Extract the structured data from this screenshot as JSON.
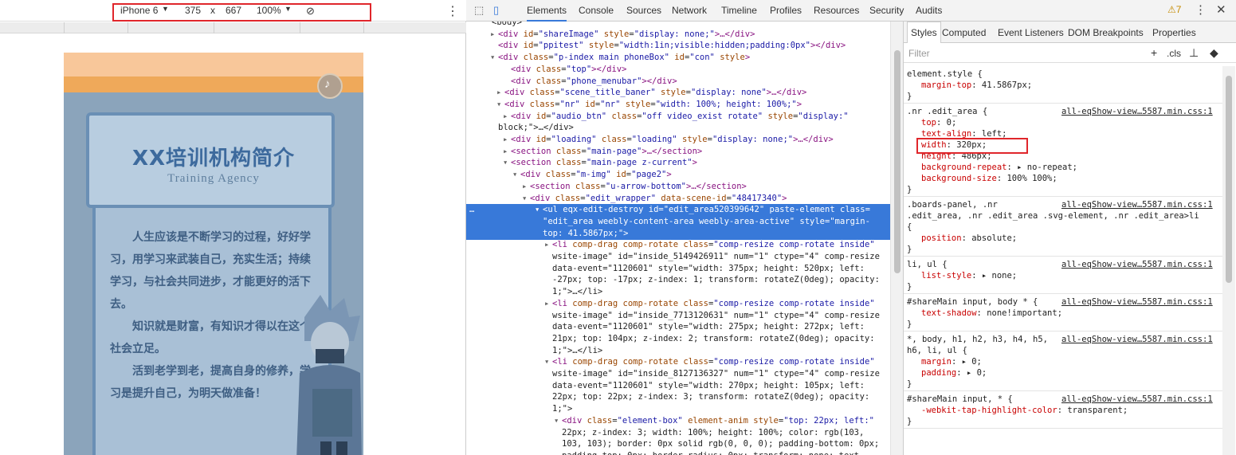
{
  "device_toolbar": {
    "device_name": "iPhone 6",
    "width": "375",
    "times": "x",
    "height": "667",
    "zoom": "100%",
    "rotate_icon": "rotate-icon",
    "more_icon": "kebab-icon"
  },
  "phone": {
    "title": "XX培训机构简介",
    "subtitle": "Training Agency",
    "paragraphs": [
      "人生应该是不断学习的过程，好好学习，用学习来武装自己，充实生活；持续学习，与社会共同进步，才能更好的活下去。",
      "知识就是财富，有知识才得以在这个社会立足。",
      "活到老学到老，提高自身的修养，学习是提升自己，为明天做准备！"
    ],
    "music_icon": "music-note-icon",
    "colors": {
      "top_band": "#f8c79a",
      "orange_band": "#efa95a",
      "background": "#8ba4bb",
      "title": "#3d6a9d"
    }
  },
  "devtools": {
    "tabs": [
      "Elements",
      "Console",
      "Sources",
      "Network",
      "Timeline",
      "Profiles",
      "Resources",
      "Security",
      "Audits"
    ],
    "active_tab": "Elements",
    "warnings": "7",
    "inspect_icon": "inspect-icon",
    "device_icon": "device-mode-icon",
    "close_icon": "close-icon"
  },
  "dom_tree": [
    {
      "t": "",
      "html": "<body>"
    },
    {
      "t": "▸",
      "tag": "div",
      "attrs": [
        [
          "id",
          "shareImage"
        ],
        [
          "style",
          "display: none;"
        ]
      ],
      "tail": ">…</div>"
    },
    {
      "t": "",
      "tag": "div",
      "attrs": [
        [
          "id",
          "ppitest"
        ],
        [
          "style",
          "width:1in;visible:hidden;padding:0px"
        ]
      ],
      "tail": "></div>"
    },
    {
      "t": "▾",
      "tag": "div",
      "attrs": [
        [
          "class",
          "p-index main phoneBox"
        ],
        [
          "id",
          "con"
        ],
        [
          "style",
          ""
        ]
      ],
      "tail": ">"
    },
    {
      "t": "",
      "tag": "div",
      "attrs": [
        [
          "class",
          "top"
        ]
      ],
      "tail": "></div>"
    },
    {
      "t": "",
      "tag": "div",
      "attrs": [
        [
          "class",
          "phone_menubar"
        ]
      ],
      "tail": "></div>"
    },
    {
      "t": "▸",
      "tag": "div",
      "attrs": [
        [
          "class",
          "scene_title_baner"
        ],
        [
          "style",
          "display: none"
        ]
      ],
      "tail": ">…</div>"
    },
    {
      "t": "▾",
      "tag": "div",
      "attrs": [
        [
          "class",
          "nr"
        ],
        [
          "id",
          "nr"
        ],
        [
          "style",
          "width: 100%; height: 100%;"
        ]
      ],
      "tail": ">"
    },
    {
      "t": "▸",
      "tag": "div",
      "attrs": [
        [
          "id",
          "audio_btn"
        ],
        [
          "class",
          "off video_exist rotate"
        ],
        [
          "style",
          "display:"
        ]
      ],
      "tail": ""
    },
    {
      "t": "",
      "html": "block;\">…</div>"
    },
    {
      "t": "▸",
      "tag": "div",
      "attrs": [
        [
          "id",
          "loading"
        ],
        [
          "class",
          "loading"
        ],
        [
          "style",
          "display: none;"
        ]
      ],
      "tail": ">…</div>"
    },
    {
      "t": "▸",
      "tag": "section",
      "attrs": [
        [
          "class",
          "main-page"
        ]
      ],
      "tail": ">…</section>"
    },
    {
      "t": "▾",
      "tag": "section",
      "attrs": [
        [
          "class",
          "main-page z-current"
        ]
      ],
      "tail": ">"
    },
    {
      "t": "▾",
      "tag": "div",
      "attrs": [
        [
          "class",
          "m-img"
        ],
        [
          "id",
          "page2"
        ]
      ],
      "tail": ">"
    },
    {
      "t": "▸",
      "tag": "section",
      "attrs": [
        [
          "class",
          "u-arrow-bottom"
        ]
      ],
      "tail": ">…</section>"
    },
    {
      "t": "▾",
      "tag": "div",
      "attrs": [
        [
          "class",
          "edit_wrapper"
        ],
        [
          "data-scene-id",
          "48417340"
        ]
      ],
      "tail": ">"
    },
    {
      "t": "▾",
      "tag": "ul",
      "attrs": [
        [
          "eqx-edit-destroy",
          ""
        ],
        [
          "id",
          "edit_area520399642"
        ],
        [
          "paste-element",
          ""
        ],
        [
          "class",
          ""
        ]
      ],
      "tail": "",
      "selected": true
    },
    {
      "t": "",
      "html": "\"edit_area weebly-content-area weebly-area-active\" style=\"margin-",
      "selected": true
    },
    {
      "t": "",
      "html": "top: 41.5867px;\">",
      "selected": true
    },
    {
      "t": "▸",
      "tag": "li",
      "attrs": [
        [
          "comp-drag",
          ""
        ],
        [
          "comp-rotate",
          ""
        ],
        [
          "class",
          "comp-resize comp-rotate inside"
        ]
      ],
      "tail": ""
    },
    {
      "t": "",
      "html": "wsite-image\" id=\"inside_5149426911\" num=\"1\" ctype=\"4\" comp-resize"
    },
    {
      "t": "",
      "html": "data-event=\"1120601\" style=\"width: 375px; height: 520px; left:"
    },
    {
      "t": "",
      "html": "-27px; top: -17px; z-index: 1; transform: rotateZ(0deg); opacity:"
    },
    {
      "t": "",
      "html": "1;\">…</li>"
    },
    {
      "t": "▸",
      "tag": "li",
      "attrs": [
        [
          "comp-drag",
          ""
        ],
        [
          "comp-rotate",
          ""
        ],
        [
          "class",
          "comp-resize comp-rotate inside"
        ]
      ],
      "tail": ""
    },
    {
      "t": "",
      "html": "wsite-image\" id=\"inside_7713120631\" num=\"1\" ctype=\"4\" comp-resize"
    },
    {
      "t": "",
      "html": "data-event=\"1120601\" style=\"width: 275px; height: 272px; left:"
    },
    {
      "t": "",
      "html": "21px; top: 104px; z-index: 2; transform: rotateZ(0deg); opacity:"
    },
    {
      "t": "",
      "html": "1;\">…</li>"
    },
    {
      "t": "▾",
      "tag": "li",
      "attrs": [
        [
          "comp-drag",
          ""
        ],
        [
          "comp-rotate",
          ""
        ],
        [
          "class",
          "comp-resize comp-rotate inside"
        ]
      ],
      "tail": ""
    },
    {
      "t": "",
      "html": "wsite-image\" id=\"inside_8127136327\" num=\"1\" ctype=\"4\" comp-resize"
    },
    {
      "t": "",
      "html": "data-event=\"1120601\" style=\"width: 270px; height: 105px; left:"
    },
    {
      "t": "",
      "html": "22px; top: 22px; z-index: 3; transform: rotateZ(0deg); opacity:"
    },
    {
      "t": "",
      "html": "1;\">"
    },
    {
      "t": "▾",
      "tag": "div",
      "attrs": [
        [
          "class",
          "element-box"
        ],
        [
          "element-anim",
          ""
        ],
        [
          "style",
          "top: 22px; left:"
        ]
      ],
      "tail": ""
    },
    {
      "t": "",
      "html": "22px; z-index: 3; width: 100%; height: 100%; color: rgb(103,"
    },
    {
      "t": "",
      "html": "103, 103); border: 0px solid rgb(0, 0, 0); padding-bottom: 0px;"
    },
    {
      "t": "",
      "html": "padding-top: 0px; border-radius: 0px; transform: none; text-"
    }
  ],
  "styles": {
    "subtabs": [
      "Styles",
      "Computed",
      "Event Listeners",
      "DOM Breakpoints",
      "Properties"
    ],
    "active_subtab": "Styles",
    "filter_placeholder": "Filter",
    "cls_label": ".cls",
    "rules": [
      {
        "selector": "element.style {",
        "source": "",
        "props": [
          [
            "margin-top",
            "41.5867px;"
          ]
        ]
      },
      {
        "selector": ".nr .edit_area {",
        "source": "all-eqShow-view…5587.min.css:1",
        "props": [
          [
            "top",
            "0;"
          ],
          [
            "text-align",
            "left;"
          ],
          [
            "width",
            "320px;"
          ],
          [
            "height",
            "486px;"
          ],
          [
            "background-repeat",
            "▸ no-repeat;"
          ],
          [
            "background-size",
            "100% 100%;"
          ]
        ]
      },
      {
        "selector": ".boards-panel, .nr",
        "source": "all-eqShow-view…5587.min.css:1",
        "extra": [
          ".edit_area, .nr .edit_area .svg-element, .nr .edit_area>li",
          "{"
        ],
        "props": [
          [
            "position",
            "absolute;"
          ]
        ]
      },
      {
        "selector": "li, ul {",
        "source": "all-eqShow-view…5587.min.css:1",
        "props": [
          [
            "list-style",
            "▸ none;"
          ]
        ]
      },
      {
        "selector": "#shareMain input, body * {",
        "source": "all-eqShow-view…5587.min.css:1",
        "props": [
          [
            "text-shadow",
            "none!important;"
          ]
        ]
      },
      {
        "selector": "*, body, h1, h2, h3, h4, h5,",
        "source": "all-eqShow-view…5587.min.css:1",
        "extra": [
          "h6, li, ul {"
        ],
        "props": [
          [
            "margin",
            "▸ 0;"
          ],
          [
            "padding",
            "▸ 0;"
          ]
        ]
      },
      {
        "selector": "#shareMain input, * {",
        "source": "all-eqShow-view…5587.min.css:1",
        "props": [
          [
            "-webkit-tap-highlight-color",
            "transparent;"
          ]
        ]
      }
    ]
  }
}
